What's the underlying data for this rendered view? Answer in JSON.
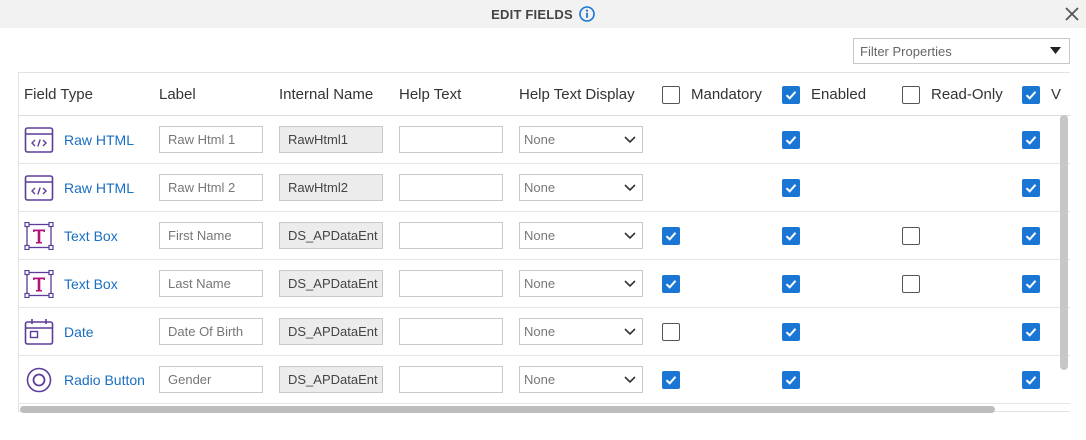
{
  "dialog": {
    "title": "EDIT FIELDS"
  },
  "filter": {
    "placeholder": "Filter Properties"
  },
  "columns": {
    "field_type": "Field Type",
    "label": "Label",
    "internal_name": "Internal Name",
    "help_text": "Help Text",
    "help_text_display": "Help Text Display",
    "mandatory": "Mandatory",
    "enabled": "Enabled",
    "read_only": "Read-Only",
    "visible_partial": "V"
  },
  "header_checks": {
    "mandatory": false,
    "enabled": true,
    "read_only": false,
    "visible": true
  },
  "rows": [
    {
      "icon": "raw-html-icon",
      "type": "Raw HTML",
      "label": "Raw Html 1",
      "internal": "RawHtml1",
      "help": "",
      "display": "None",
      "mandatory": null,
      "enabled": true,
      "read_only": null,
      "visible": true
    },
    {
      "icon": "raw-html-icon",
      "type": "Raw HTML",
      "label": "Raw Html 2",
      "internal": "RawHtml2",
      "help": "",
      "display": "None",
      "mandatory": null,
      "enabled": true,
      "read_only": null,
      "visible": true
    },
    {
      "icon": "text-box-icon",
      "type": "Text Box",
      "label": "First Name",
      "internal": "DS_APDataEnt",
      "help": "",
      "display": "None",
      "mandatory": true,
      "enabled": true,
      "read_only": false,
      "visible": true
    },
    {
      "icon": "text-box-icon",
      "type": "Text Box",
      "label": "Last Name",
      "internal": "DS_APDataEnt",
      "help": "",
      "display": "None",
      "mandatory": true,
      "enabled": true,
      "read_only": false,
      "visible": true
    },
    {
      "icon": "calendar-icon",
      "type": "Date",
      "label": "Date Of Birth",
      "internal": "DS_APDataEnt",
      "help": "",
      "display": "None",
      "mandatory": false,
      "enabled": true,
      "read_only": null,
      "visible": true
    },
    {
      "icon": "radio-button-icon",
      "type": "Radio Button",
      "label": "Gender",
      "internal": "DS_APDataEnt",
      "help": "",
      "display": "None",
      "mandatory": true,
      "enabled": true,
      "read_only": null,
      "visible": true
    }
  ],
  "colors": {
    "accent": "#1976d2",
    "link": "#1a6fc0",
    "icon_purple": "#5c3d99",
    "textbox_pink": "#b0157a"
  }
}
